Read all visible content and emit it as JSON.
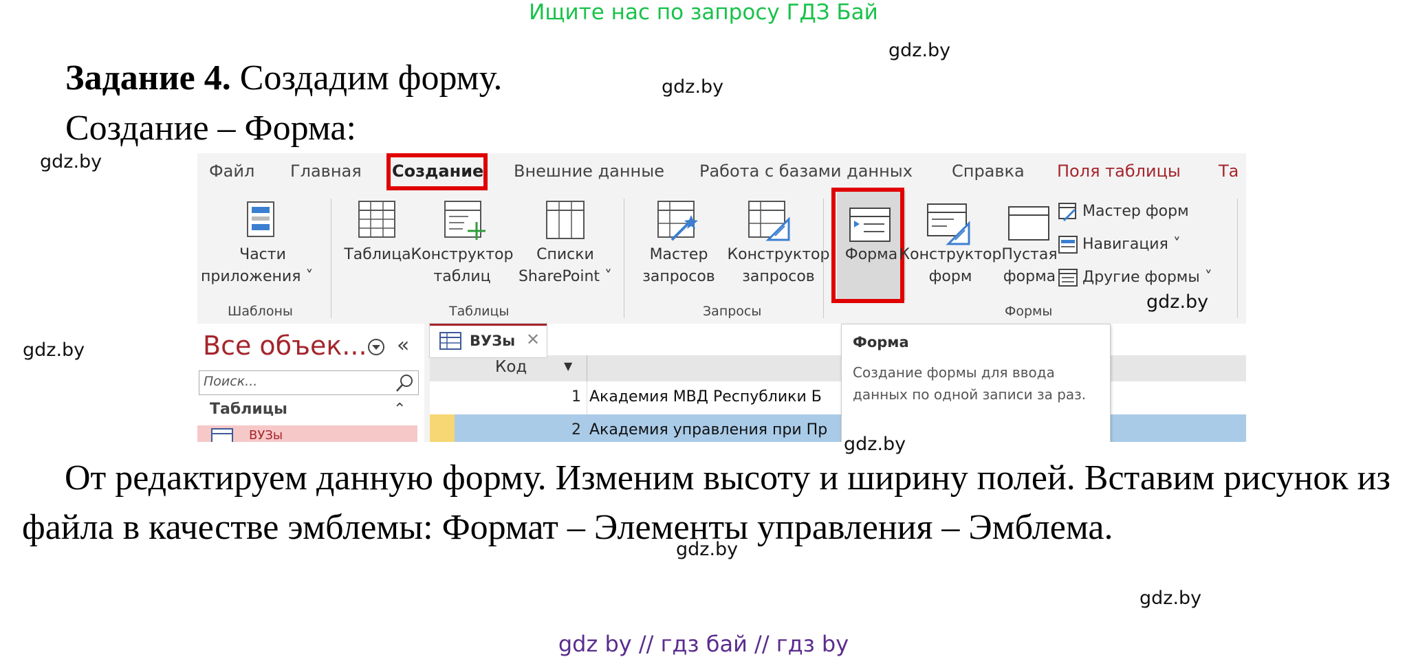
{
  "banner": "Ищите нас по запросу ГДЗ Бай",
  "watermark": "gdz.by",
  "heading": {
    "bold": "Задание 4.",
    "rest": " Создадим форму."
  },
  "subline": "Создание – Форма:",
  "paragraph": "От редактируем данную форму. Изменим высоту и ширину полей. Вставим рисунок из файла в качестве эмблемы: Формат – Элементы управления – Эмблема.",
  "footer": "gdz by  //  гдз бай  //  гдз by",
  "screenshot": {
    "tabs": [
      "Файл",
      "Главная",
      "Создание",
      "Внешние данные",
      "Работа с базами данных",
      "Справка",
      "Поля таблицы",
      "Та"
    ],
    "groups": [
      "Шаблоны",
      "Таблицы",
      "Запросы",
      "Формы"
    ],
    "buttons": {
      "parts_1": "Части",
      "parts_2": "приложения ˅",
      "table": "Таблица",
      "table_designer_1": "Конструктор",
      "table_designer_2": "таблиц",
      "sharepoint_1": "Списки",
      "sharepoint_2": "SharePoint ˅",
      "query_wizard_1": "Мастер",
      "query_wizard_2": "запросов",
      "query_designer_1": "Конструктор",
      "query_designer_2": "запросов",
      "form": "Форма",
      "form_designer_1": "Конструктор",
      "form_designer_2": "форм",
      "blank_form_1": "Пустая",
      "blank_form_2": "форма",
      "form_wizard": "Мастер форм",
      "navigation": "Навигация ˅",
      "other_forms": "Другие формы ˅"
    },
    "nav": {
      "title": "Все объек...",
      "search_placeholder": "Поиск...",
      "section": "Таблицы",
      "item": "ВУЗы"
    },
    "doc": {
      "tab": "ВУЗы",
      "column": "Код",
      "rows": [
        {
          "id": "1",
          "name": "Академия МВД Республики Б"
        },
        {
          "id": "2",
          "name": "Академия управления при Пр"
        }
      ]
    },
    "tooltip": {
      "title": "Форма",
      "description": "Создание формы для ввода данных по одной записи за раз."
    }
  }
}
